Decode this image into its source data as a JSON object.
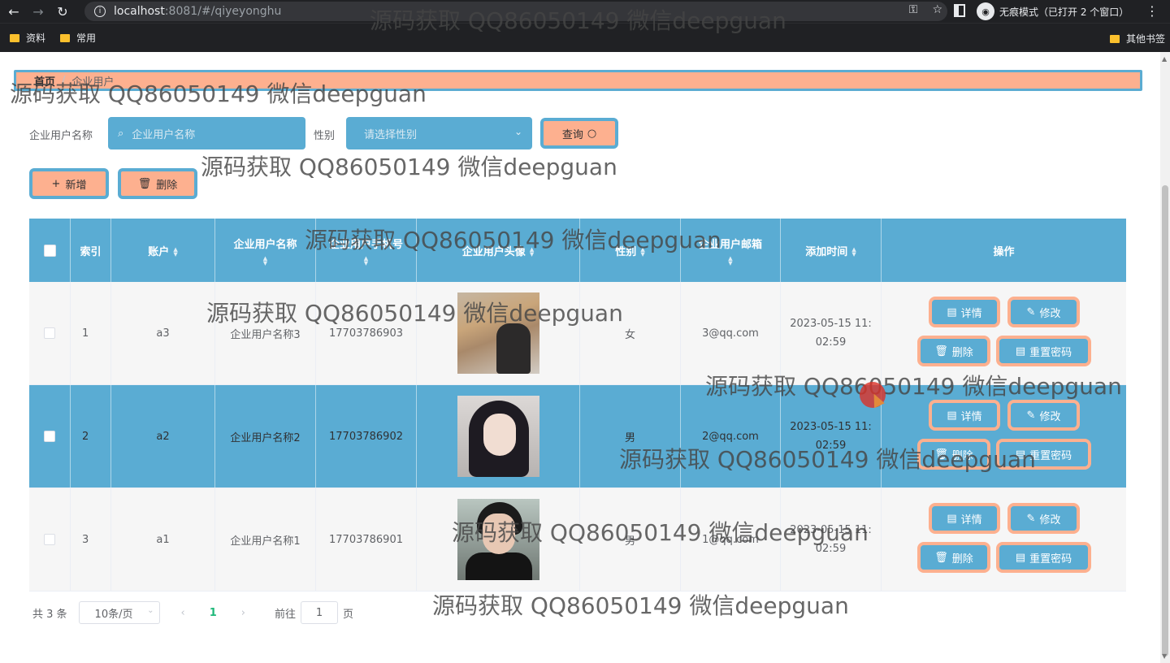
{
  "browser": {
    "url_host": "localhost",
    "url_path": ":8081/#/qiyeyonghu",
    "incognito_label": "无痕模式（已打开 2 个窗口）",
    "bookmarks": [
      "资料",
      "常用"
    ],
    "bookmarks_right": "其他书签"
  },
  "breadcrumb": {
    "home": "首页",
    "separator": "/",
    "current": "企业用户"
  },
  "filters": {
    "name_label": "企业用户名称",
    "name_placeholder": "企业用户名称",
    "gender_label": "性别",
    "gender_placeholder": "请选择性别",
    "query_label": "查询"
  },
  "actions": {
    "add_label": "新增",
    "delete_label": "删除"
  },
  "table": {
    "headers": {
      "index": "索引",
      "account": "账户",
      "name": "企业用户名称",
      "phone": "企业用户手机号",
      "avatar": "企业用户头像",
      "gender": "性别",
      "email": "企业用户邮箱",
      "added": "添加时间",
      "ops": "操作"
    },
    "rows": [
      {
        "index": "1",
        "account": "a3",
        "name": "企业用户名称3",
        "phone": "17703786903",
        "gender": "女",
        "email": "3@qq.com",
        "added_date": "2023-05-15 11:",
        "added_time": "02:59"
      },
      {
        "index": "2",
        "account": "a2",
        "name": "企业用户名称2",
        "phone": "17703786902",
        "gender": "男",
        "email": "2@qq.com",
        "added_date": "2023-05-15 11:",
        "added_time": "02:59"
      },
      {
        "index": "3",
        "account": "a1",
        "name": "企业用户名称1",
        "phone": "17703786901",
        "gender": "男",
        "email": "1@qq.com",
        "added_date": "2023-05-15 11:",
        "added_time": "02:59"
      }
    ],
    "op_labels": {
      "detail": "详情",
      "edit": "修改",
      "delete": "删除",
      "reset": "重置密码"
    }
  },
  "pagination": {
    "total": "共 3 条",
    "page_size": "10条/页",
    "current_page": "1",
    "goto_prefix": "前往",
    "goto_value": "1",
    "goto_suffix": "页"
  },
  "watermark": "源码获取 QQ86050149 微信deepguan",
  "colors": {
    "accent_blue": "#5aacd3",
    "accent_peach": "#fdb08f"
  }
}
